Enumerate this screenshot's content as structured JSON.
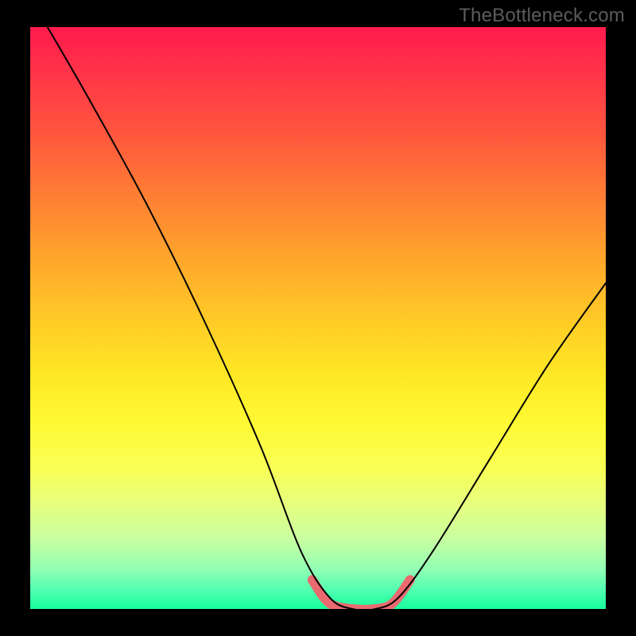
{
  "watermark": "TheBottleneck.com",
  "chart_data": {
    "type": "line",
    "title": "",
    "xlabel": "",
    "ylabel": "",
    "x_range": [
      0,
      1
    ],
    "y_range": [
      0,
      1
    ],
    "series": [
      {
        "name": "bottleneck-curve",
        "x": [
          0.03,
          0.1,
          0.2,
          0.3,
          0.4,
          0.47,
          0.52,
          0.56,
          0.6,
          0.64,
          0.7,
          0.8,
          0.9,
          1.0
        ],
        "y": [
          1.0,
          0.88,
          0.7,
          0.5,
          0.28,
          0.1,
          0.02,
          0.0,
          0.0,
          0.02,
          0.1,
          0.26,
          0.42,
          0.56
        ]
      }
    ],
    "highlight_segment": {
      "name": "minimum-region",
      "x": [
        0.49,
        0.52,
        0.56,
        0.6,
        0.63,
        0.66
      ],
      "y": [
        0.05,
        0.01,
        0.0,
        0.0,
        0.01,
        0.05
      ],
      "color": "#e96a6f"
    },
    "background_gradient": {
      "type": "vertical",
      "stops": [
        "#ff1a4d",
        "#ff553e",
        "#ffae2a",
        "#ffe825",
        "#e6ff7e",
        "#17ff9b"
      ]
    }
  }
}
